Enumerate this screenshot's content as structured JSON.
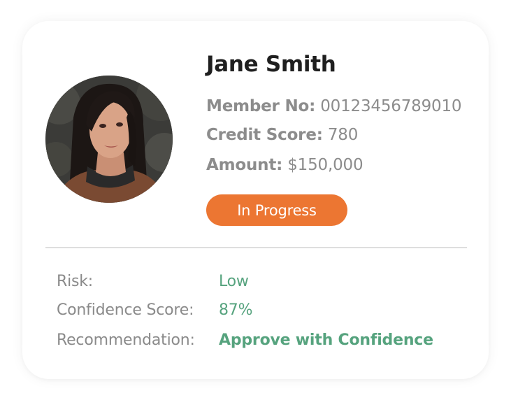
{
  "profile": {
    "name": "Jane Smith",
    "avatar_alt": "avatar",
    "member_label": "Member No:",
    "member_value": "00123456789010",
    "credit_label": "Credit Score:",
    "credit_value": "780",
    "amount_label": "Amount:",
    "amount_value": "$150,000"
  },
  "status": {
    "label": "In Progress",
    "color": "#ec7632"
  },
  "details": {
    "risk_label": "Risk:",
    "risk_value": "Low",
    "confidence_label": "Confidence Score:",
    "confidence_value": "87%",
    "recommendation_label": "Recommendation:",
    "recommendation_value": "Approve with Confidence",
    "value_color": "#56a37e"
  }
}
